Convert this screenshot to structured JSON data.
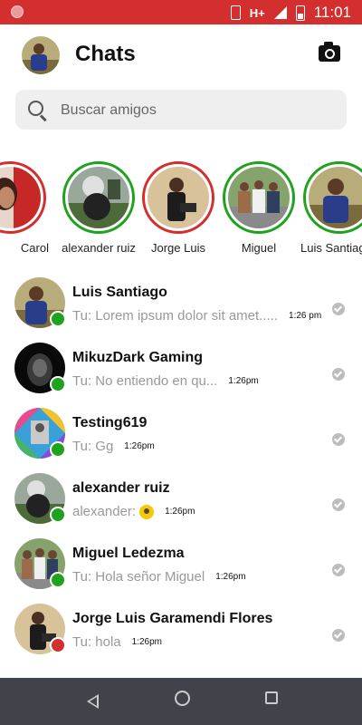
{
  "status_bar": {
    "network": "H+",
    "time": "11:01"
  },
  "header": {
    "title": "Chats"
  },
  "search": {
    "placeholder": "Buscar amigos"
  },
  "colors": {
    "status_bar": "#d32f2f",
    "online": "#1fa31f",
    "offline": "#d32f2f",
    "nav_bar": "#404349"
  },
  "stories": [
    {
      "name": "Carol",
      "ring": "#d32f2f"
    },
    {
      "name": "alexander ruiz",
      "ring": "#1fa31f"
    },
    {
      "name": "Jorge Luis",
      "ring": "#d32f2f"
    },
    {
      "name": "Miguel",
      "ring": "#1fa31f"
    },
    {
      "name": "Luis Santiago",
      "ring": "#1fa31f"
    }
  ],
  "chats": [
    {
      "name": "Luis Santiago",
      "preview": "Tu: Lorem ipsum dolor sit amet.....",
      "time": "1:26 pm",
      "status": "online"
    },
    {
      "name": "MikuzDark Gaming",
      "preview": "Tu:  No entiendo en qu...",
      "time": "1:26pm",
      "status": "online"
    },
    {
      "name": "Testing619",
      "preview": "Tu:  Gg",
      "time": "1:26pm",
      "status": "online"
    },
    {
      "name": "alexander ruiz",
      "preview": "alexander:",
      "time": "1:26pm",
      "status": "online"
    },
    {
      "name": "Miguel Ledezma",
      "preview": "Tu:  Hola señor Miguel",
      "time": "1:26pm",
      "status": "online"
    },
    {
      "name": "Jorge Luis Garamendi Flores",
      "preview": "Tu:  hola",
      "time": "1:26pm",
      "status": "offline"
    }
  ]
}
